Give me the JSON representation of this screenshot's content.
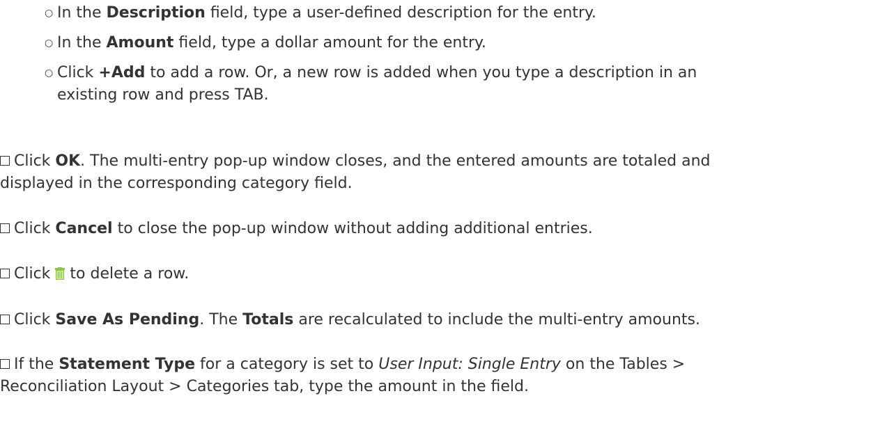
{
  "sub_items": [
    {
      "pre": "In the ",
      "bold": "Description",
      "post": " field, type a user-defined description for the entry."
    },
    {
      "pre": "In the ",
      "bold": "Amount",
      "post": " field, type a dollar amount for the entry."
    },
    {
      "pre": "Click ",
      "bold": "+Add",
      "post": " to add a row. Or, a new row is added when you type a description in an",
      "post2": "existing row and press TAB."
    }
  ],
  "para_ok": {
    "pre": "Click ",
    "bold": "OK",
    "post": ". The multi-entry pop-up window closes, and the entered amounts are totaled and",
    "line2": "displayed in the corresponding category field."
  },
  "para_cancel": {
    "pre": "Click ",
    "bold": "Cancel",
    "post": " to close the pop-up window without adding additional entries."
  },
  "para_delete": {
    "pre": "Click ",
    "post": " to delete a row."
  },
  "para_save": {
    "pre": "Click ",
    "bold": "Save As Pending",
    "mid": ". The ",
    "bold2": "Totals",
    "post": " are recalculated to include the multi-entry amounts."
  },
  "para_statement": {
    "pre": "If the ",
    "bold": "Statement Type",
    "mid": " for a category is set to ",
    "italic": "User Input: Single Entry",
    "post": " on the Tables >",
    "line2": "Reconciliation Layout > Categories tab, type the amount in the field."
  },
  "colors": {
    "trash_green": "#8cc63f"
  }
}
